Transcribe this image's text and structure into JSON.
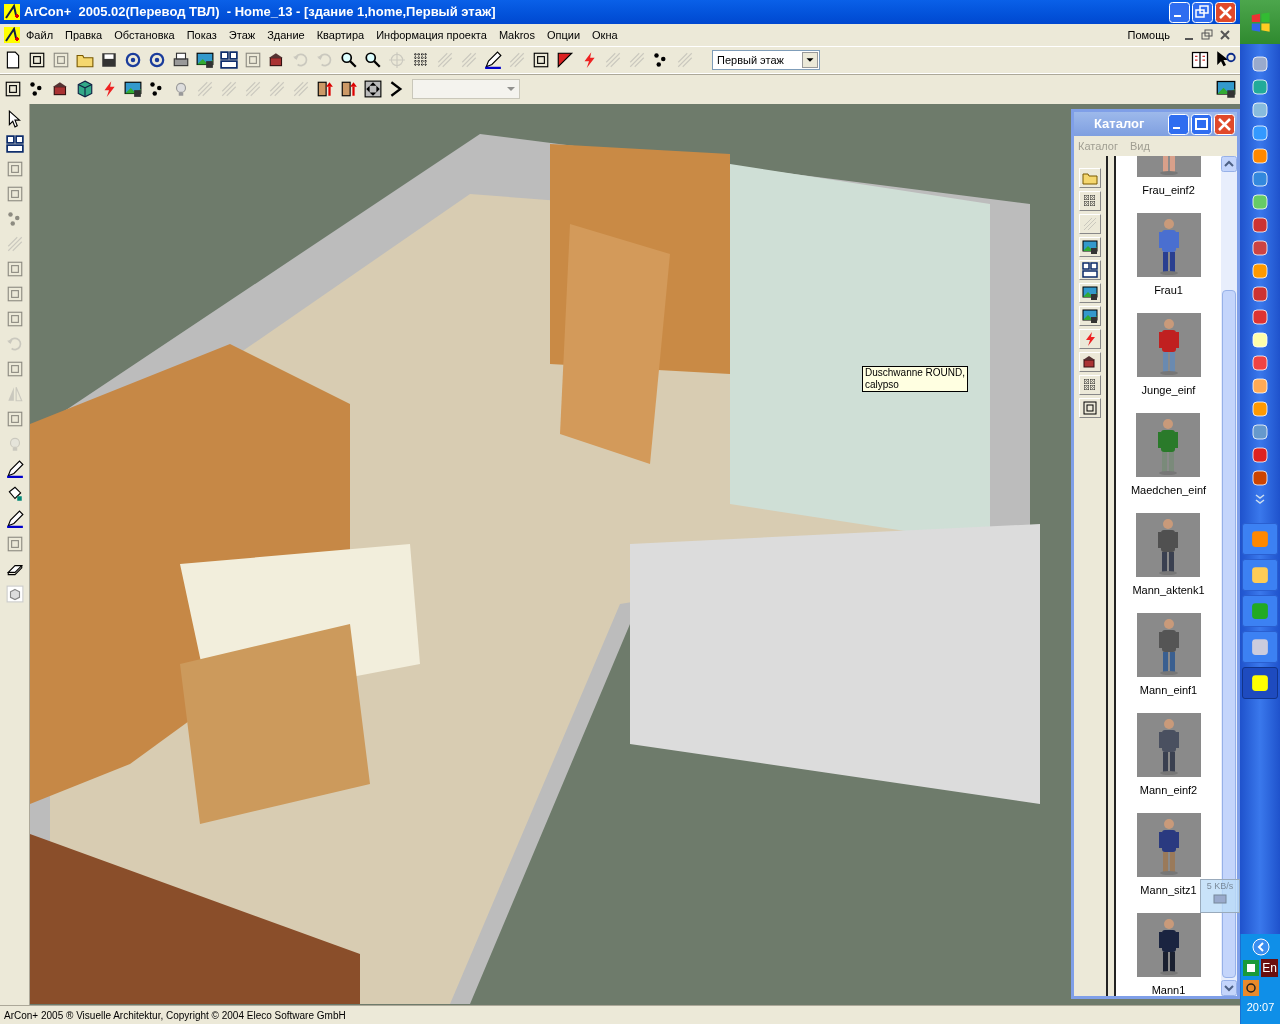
{
  "window": {
    "title": "ArCon+  2005.02(Перевод ТВЛ)  - Home_13 - [здание 1,home,Первый этаж]"
  },
  "menu": [
    "Файл",
    "Правка",
    "Обстановка",
    "Показ",
    "Этаж",
    "Здание",
    "Квартира",
    "Информация проекта",
    "Makros",
    "Опции",
    "Окна"
  ],
  "menu_right": "Помощь",
  "floor_select": {
    "value": "Первый этаж"
  },
  "tooltip": {
    "lines": [
      "Duschwanne ROUND,",
      "calypso"
    ]
  },
  "catalog": {
    "title": "Каталог",
    "menu": [
      {
        "label": "Каталог",
        "disabled": true
      },
      {
        "label": "Вид",
        "disabled": true
      }
    ],
    "items": [
      {
        "label": "Frau_einf2"
      },
      {
        "label": "Frau1"
      },
      {
        "label": "Junge_einf"
      },
      {
        "label": "Maedchen_einf"
      },
      {
        "label": "Mann_aktenk1"
      },
      {
        "label": "Mann_einf1"
      },
      {
        "label": "Mann_einf2"
      },
      {
        "label": "Mann_sitz1"
      },
      {
        "label": "Mann1"
      }
    ]
  },
  "network_meter": {
    "reading": "5 KB/s"
  },
  "taskbar": {
    "language": "En",
    "clock": "20:07"
  },
  "status_bar": "ArCon+ 2005 ® Visuelle Architektur, Copyright © 2004 Eleco Software GmbH"
}
